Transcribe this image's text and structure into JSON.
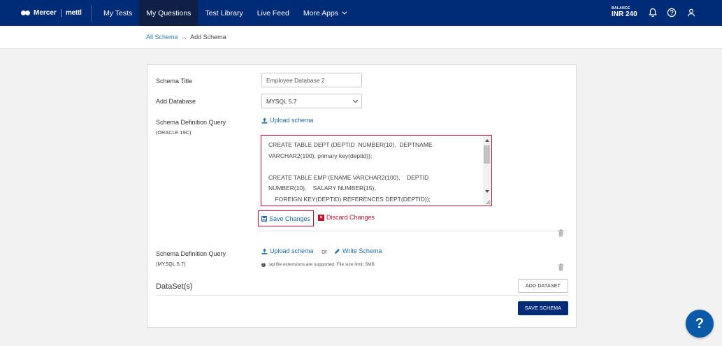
{
  "brand": {
    "name": "Mercer",
    "sub": "mettl"
  },
  "nav": [
    {
      "label": "My Tests",
      "active": false
    },
    {
      "label": "My Questions",
      "active": true
    },
    {
      "label": "Test Library",
      "active": false
    },
    {
      "label": "Live Feed",
      "active": false
    },
    {
      "label": "More Apps",
      "active": false
    }
  ],
  "balance": {
    "label": "BALANCE",
    "value": "INR 240"
  },
  "breadcrumb": {
    "link": "All Schema",
    "arrow": "→",
    "current": "Add Schema"
  },
  "form": {
    "title_label": "Schema Title",
    "title_value": "Employee Database 2",
    "database_label": "Add Database",
    "database_value": "MYSQL 5.7",
    "query1_label": "Schema Definition Query",
    "query1_sub": "(ORACLE 19C)",
    "upload_schema": "Upload schema",
    "sql_text": "CREATE TABLE DEPT (DEPTID  NUMBER(10),  DEPTNAME\nVARCHAR2(100), primary key(deptid));\n\nCREATE TABLE EMP (ENAME VARCHAR2(100),    DEPTID\nNUMBER(10),    SALARY NUMBER(15),\n    FOREIGN KEY(DEPTID) REFERENCES DEPT(DEPTID));",
    "save_changes": "Save Changes",
    "discard_changes": "Discard Changes",
    "query2_label": "Schema Definition Query",
    "query2_sub": "(MYSQL 5.7)",
    "upload_schema2": "Upload schema",
    "or": "or",
    "write_schema": "Write Schema",
    "note": ".sql file extensions are supported. File size limit: 5MB"
  },
  "dataset": {
    "title": "DataSet(s)",
    "add_button": "ADD DATASET"
  },
  "save_schema": "SAVE SCHEMA",
  "help": "?",
  "colors": {
    "nav_bg": "#002c77",
    "link": "#1e6aa8",
    "danger": "#c8102e",
    "fab": "#0a5aa8"
  }
}
